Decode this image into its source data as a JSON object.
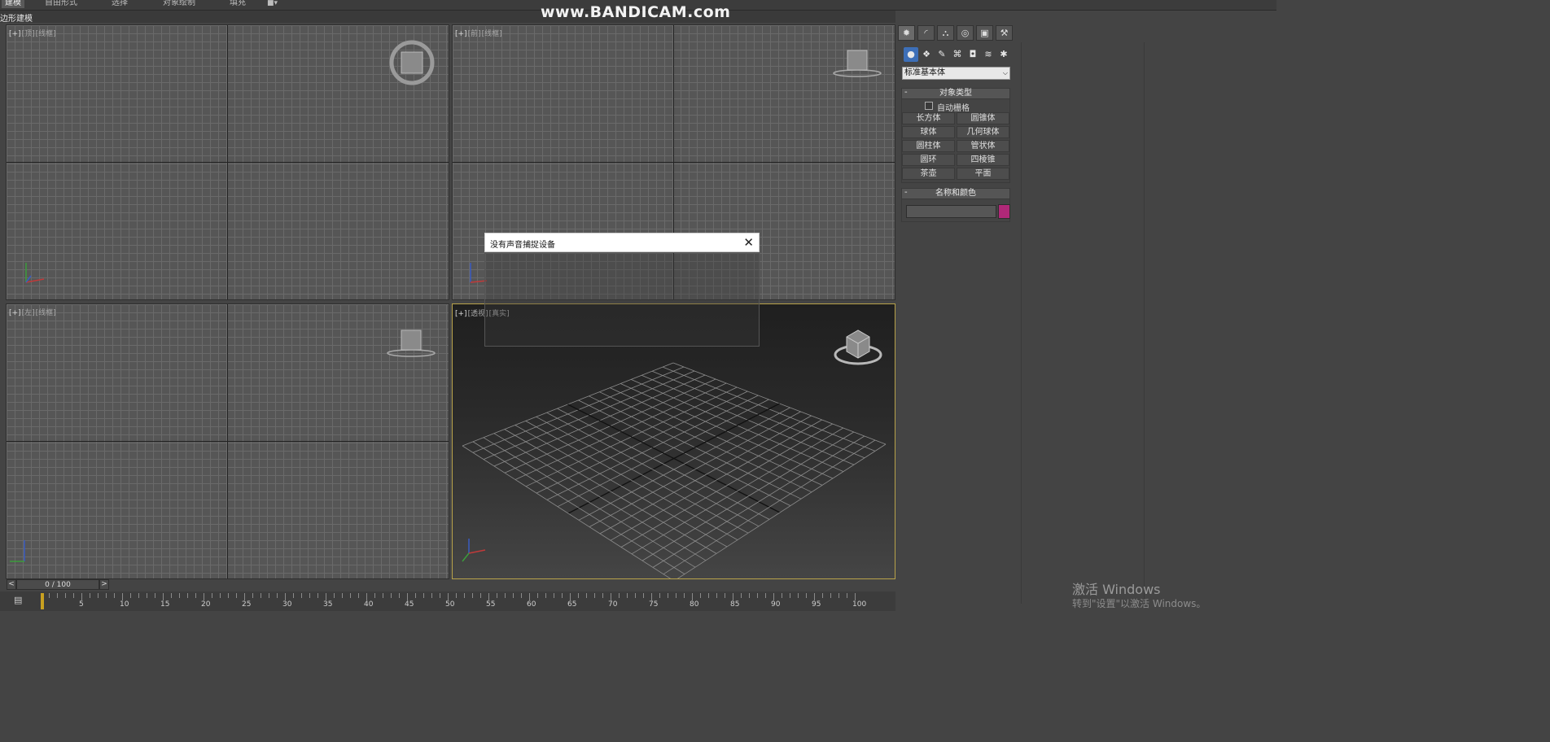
{
  "ribbon": {
    "tabs": [
      "建模",
      "自由形式",
      "选择",
      "对象绘制",
      "填充"
    ],
    "sub_label": "边形建模"
  },
  "watermark": "www.BANDICAM.com",
  "viewports": {
    "top": {
      "plus": "[+]",
      "name": "[顶]",
      "mode": "[线框]"
    },
    "front": {
      "plus": "[+]",
      "name": "[前]",
      "mode": "[线框]"
    },
    "left": {
      "plus": "[+]",
      "name": "[左]",
      "mode": "[线框]"
    },
    "persp": {
      "plus": "[+]",
      "name": "[透视]",
      "mode": "[真实]"
    }
  },
  "command_panel": {
    "tab_icons": [
      "create-icon",
      "modify-icon",
      "hierarchy-icon",
      "motion-icon",
      "display-icon",
      "utilities-icon"
    ],
    "category_icons": [
      "geometry-icon",
      "shapes-icon",
      "lights-icon",
      "cameras-icon",
      "helpers-icon",
      "spacewarps-icon",
      "systems-icon"
    ],
    "dropdown_value": "标准基本体",
    "object_type": {
      "header": "对象类型",
      "autogrid_label": "自动栅格",
      "buttons": [
        "长方体",
        "圆锥体",
        "球体",
        "几何球体",
        "圆柱体",
        "管状体",
        "圆环",
        "四棱锥",
        "茶壶",
        "平面"
      ]
    },
    "name_color": {
      "header": "名称和颜色",
      "name_value": "",
      "color": "#b02878"
    }
  },
  "dialog": {
    "title": "没有声音捕捉设备",
    "close": "✕"
  },
  "timeline": {
    "slider_text": "0 / 100",
    "prev": "<",
    "next": ">",
    "ticks": [
      "5",
      "10",
      "15",
      "20",
      "25",
      "30",
      "35",
      "40",
      "45",
      "50",
      "55",
      "60",
      "65",
      "70",
      "75",
      "80",
      "85",
      "90",
      "95",
      "100"
    ]
  },
  "windows_activation": {
    "line1": "激活 Windows",
    "line2": "转到\"设置\"以激活 Windows。"
  }
}
